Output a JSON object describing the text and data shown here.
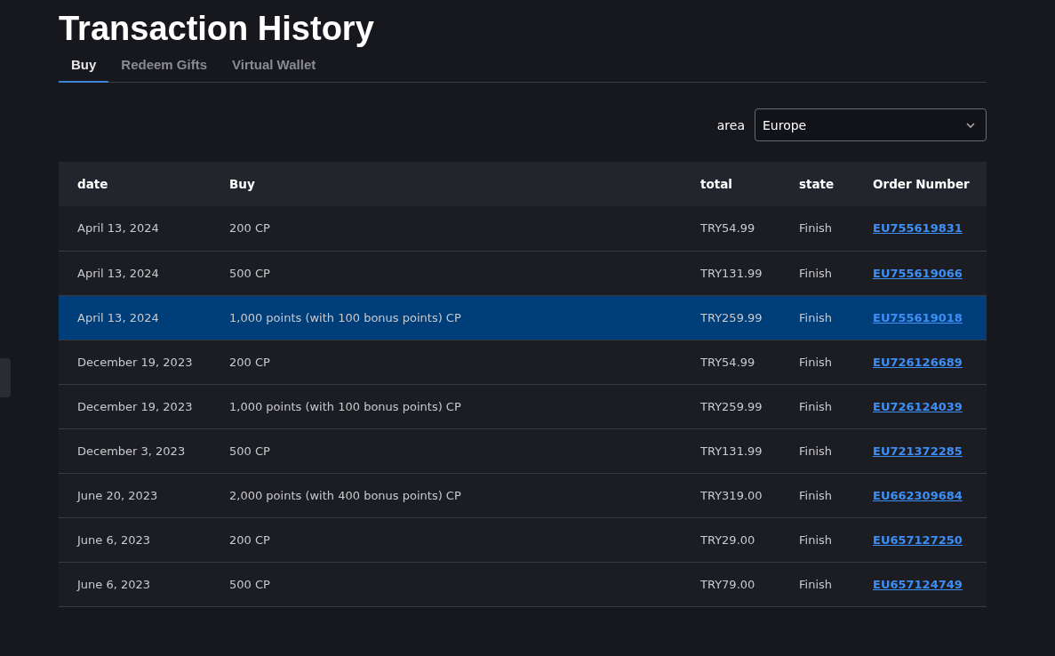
{
  "title": "Transaction History",
  "tabs": [
    {
      "label": "Buy",
      "selected": true
    },
    {
      "label": "Redeem Gifts",
      "selected": false
    },
    {
      "label": "Virtual Wallet",
      "selected": false
    }
  ],
  "area_filter": {
    "label": "area",
    "value": "Europe"
  },
  "table": {
    "columns": [
      "date",
      "Buy",
      "total",
      "state",
      "Order Number"
    ],
    "rows": [
      {
        "date": "April 13, 2024",
        "buy": "200 CP",
        "total": "TRY54.99",
        "state": "Finish",
        "order": "EU755619831",
        "selected": false
      },
      {
        "date": "April 13, 2024",
        "buy": "500 CP",
        "total": "TRY131.99",
        "state": "Finish",
        "order": "EU755619066",
        "selected": false
      },
      {
        "date": "April 13, 2024",
        "buy": "1,000 points (with 100 bonus points) CP",
        "total": "TRY259.99",
        "state": "Finish",
        "order": "EU755619018",
        "selected": true
      },
      {
        "date": "December 19, 2023",
        "buy": "200 CP",
        "total": "TRY54.99",
        "state": "Finish",
        "order": "EU726126689",
        "selected": false
      },
      {
        "date": "December 19, 2023",
        "buy": "1,000 points (with 100 bonus points) CP",
        "total": "TRY259.99",
        "state": "Finish",
        "order": "EU726124039",
        "selected": false
      },
      {
        "date": "December 3, 2023",
        "buy": "500 CP",
        "total": "TRY131.99",
        "state": "Finish",
        "order": "EU721372285",
        "selected": false
      },
      {
        "date": "June 20, 2023",
        "buy": "2,000 points (with 400 bonus points) CP",
        "total": "TRY319.00",
        "state": "Finish",
        "order": "EU662309684",
        "selected": false
      },
      {
        "date": "June 6, 2023",
        "buy": "200 CP",
        "total": "TRY29.00",
        "state": "Finish",
        "order": "EU657127250",
        "selected": false
      },
      {
        "date": "June 6, 2023",
        "buy": "500 CP",
        "total": "TRY79.00",
        "state": "Finish",
        "order": "EU657124749",
        "selected": false
      }
    ]
  }
}
